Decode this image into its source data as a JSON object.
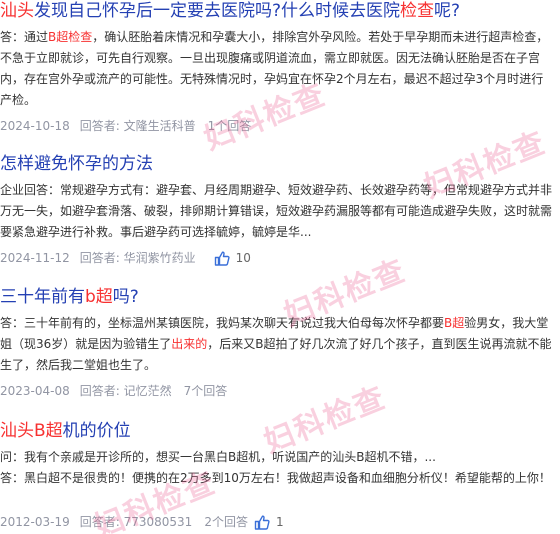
{
  "results": [
    {
      "title_parts": [
        {
          "text": "汕头",
          "hl": true
        },
        {
          "text": "发现自己怀孕后一定要去医院吗?什么时候去医院",
          "hl": false
        },
        {
          "text": "检查",
          "hl": true
        },
        {
          "text": "呢?",
          "hl": false
        }
      ],
      "abstract_parts": [
        {
          "text": "答：通过",
          "hl": false
        },
        {
          "text": "B超检查",
          "hl": true
        },
        {
          "text": "，确认胚胎着床情况和孕囊大小，排除宫外孕风险。若处于早孕期而未进行超声检查，不急于立即就诊，可先自行观察。一旦出现腹痛或阴道流血，需立即就医。因无法确认胚胎是否在子宫内，存在宫外孕或流产的可能性。无特殊情况时，孕妈宜在怀孕2个月左右，最迟不超过孕3个月时进行产检。",
          "hl": false
        }
      ],
      "date": "2024-10-18",
      "answerer": "回答者: 文隆生活科普",
      "count": "1个回答",
      "likes": ""
    },
    {
      "title_parts": [
        {
          "text": "怎样避免怀孕的方法",
          "hl": false
        }
      ],
      "abstract_parts": [
        {
          "text": "企业回答：常规避孕方式有：避孕套、月经周期避孕、短效避孕药、长效避孕药等，但常规避孕方式并非万无一失，如避孕套滑落、破裂，排卵期计算错误，短效避孕药漏服等都有可能造成避孕失败，这时就需要紧急避孕进行补救。事后避孕药可选择毓婷，毓婷是华...",
          "hl": false
        }
      ],
      "date": "2024-11-12",
      "answerer": "回答者: 华润紫竹药业",
      "count": "",
      "likes": "10"
    },
    {
      "title_parts": [
        {
          "text": "三十年前有",
          "hl": false
        },
        {
          "text": "b超",
          "hl": true
        },
        {
          "text": "吗?",
          "hl": false
        }
      ],
      "abstract_parts": [
        {
          "text": "答：三十年前有的，坐标温州某镇医院，我妈某次聊天有说过我大伯母每次怀孕都要",
          "hl": false
        },
        {
          "text": "B超",
          "hl": true
        },
        {
          "text": "验男女，我大堂姐（现36岁）就是因为验错生了",
          "hl": false
        },
        {
          "text": "出来的",
          "hl": true
        },
        {
          "text": "，后来又B超拍了好几次流了好几个孩子，直到医生说再流就不能生了，然后我二堂姐也生了。",
          "hl": false
        }
      ],
      "date": "2023-04-08",
      "answerer": "回答者: 记忆茫然",
      "count": "7个回答",
      "likes": ""
    },
    {
      "title_parts": [
        {
          "text": "汕头",
          "hl": true
        },
        {
          "text": "B超",
          "hl": true
        },
        {
          "text": "机的价位",
          "hl": false
        }
      ],
      "abstract_parts": [
        {
          "text": "问：我有个亲戚是开诊所的，想买一台黑白B超机，听说国产的汕头B超机不错，...",
          "hl": false
        },
        {
          "text": "答：黑白超不是很贵的！便携的在2万多到10万左右！我做超声设备和血细胞分析仪！希望能帮的上你！",
          "hl": false
        }
      ],
      "date": "2012-03-19",
      "answerer": "回答者: 773080531",
      "count": "2个回答",
      "likes": "1"
    }
  ],
  "watermark": "妇科检查",
  "colors": {
    "title": "#2440b3",
    "highlight": "#f73131",
    "meta": "#9195a3",
    "like_icon": "#3a6fd8"
  },
  "icons": {
    "like": "thumbs-up-icon"
  }
}
